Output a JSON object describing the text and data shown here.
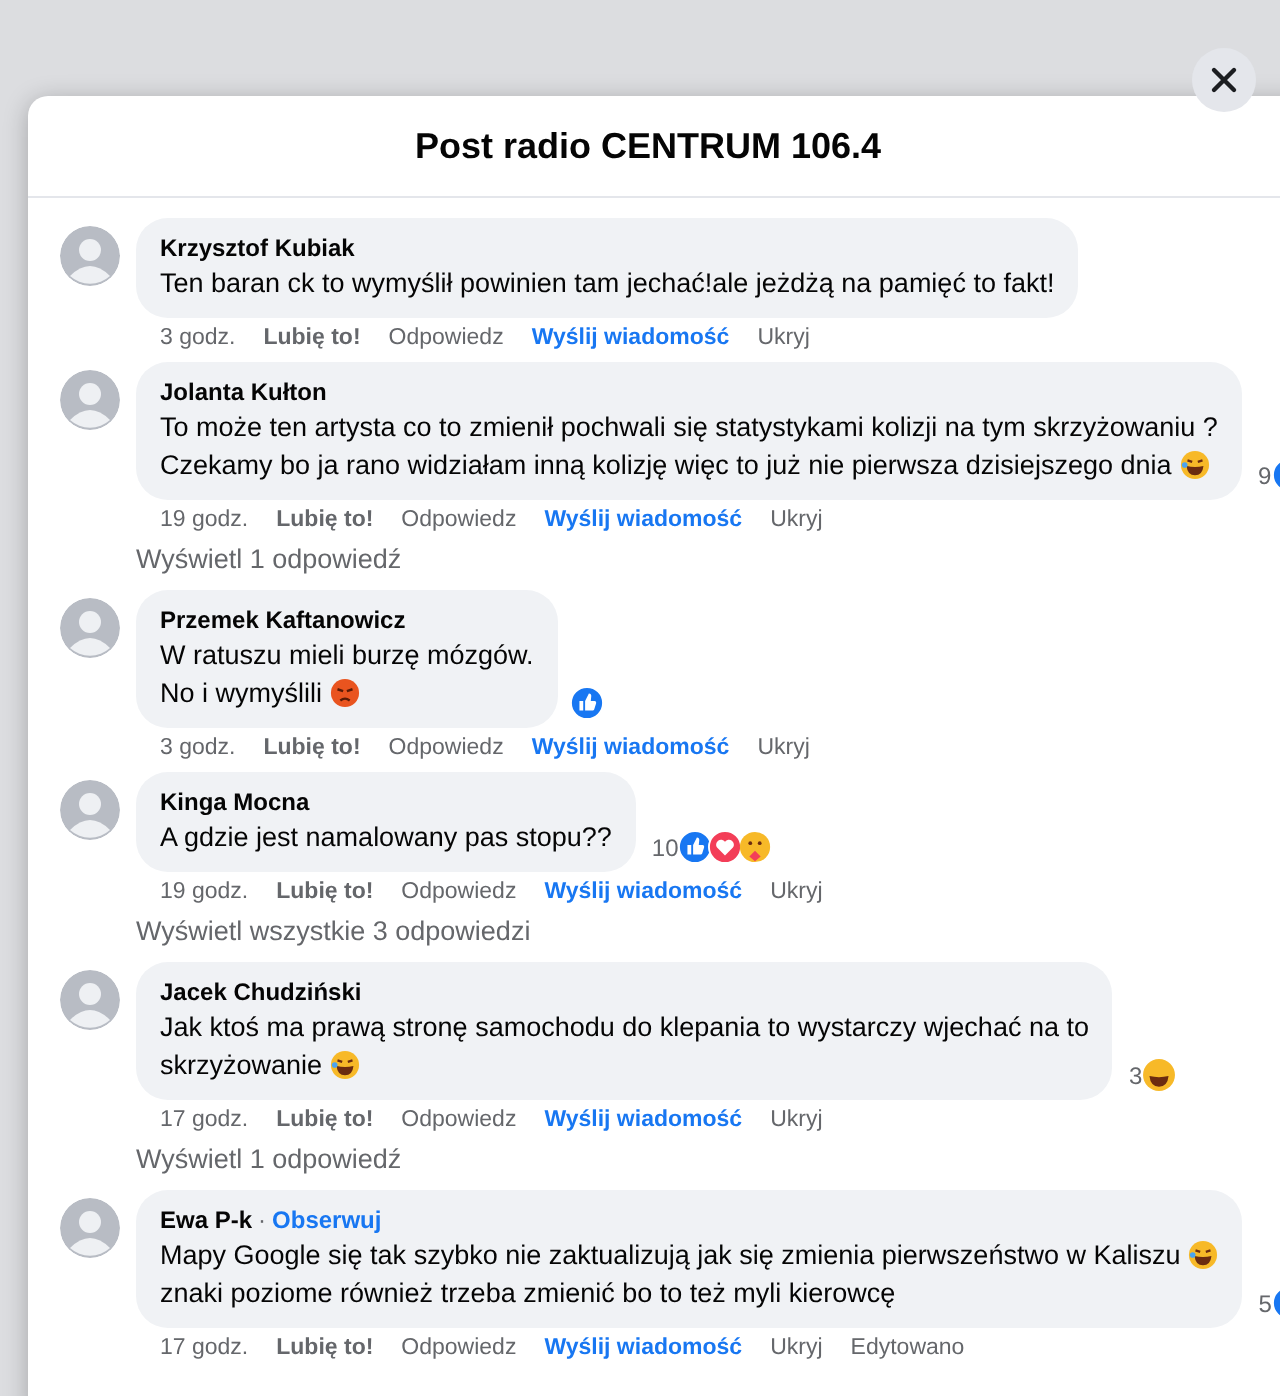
{
  "dialog": {
    "title": "Post radio CENTRUM 106.4"
  },
  "comments": [
    {
      "name": "Krzysztof Kubiak",
      "lines": [
        {
          "text": "Ten baran ck to wymyślił powinien tam jechać!ale jeżdżą na pamięć to fakt!"
        }
      ],
      "time": "3 godz.",
      "actions": [
        "Lubię to!",
        "Odpowiedz"
      ],
      "message": "Wyślij wiadomość",
      "hide": "Ukryj"
    },
    {
      "name": "Jolanta Kułton",
      "lines": [
        {
          "text": "To może ten artysta co to zmienił pochwali się statystykami kolizji na tym skrzyżowaniu ?"
        },
        {
          "text": "Czekamy bo ja rano widziałam inną kolizję więc to już nie pierwsza dzisiejszego dnia",
          "emoji": {
            "kind": "laugh"
          }
        }
      ],
      "time": "19 godz.",
      "actions": [
        "Lubię to!",
        "Odpowiedz"
      ],
      "message": "Wyślij wiadomość",
      "hide": "Ukryj",
      "reactions": {
        "count": "9",
        "icons": [
          {
            "kind": "like"
          }
        ]
      },
      "replies_link": "Wyświetl 1 odpowiedź"
    },
    {
      "name": "Przemek Kaftanowicz",
      "lines": [
        {
          "text": "W ratuszu mieli burzę mózgów."
        },
        {
          "text": "No i wymyślili",
          "emoji": {
            "kind": "angry"
          }
        }
      ],
      "time": "3 godz.",
      "actions": [
        "Lubię to!",
        "Odpowiedz"
      ],
      "message": "Wyślij wiadomość",
      "hide": "Ukryj",
      "reactions": {
        "icons": [
          {
            "kind": "like"
          }
        ]
      }
    },
    {
      "name": "Kinga Mocna",
      "lines": [
        {
          "text": "A gdzie jest namalowany pas stopu??"
        }
      ],
      "time": "19 godz.",
      "actions": [
        "Lubię to!",
        "Odpowiedz"
      ],
      "message": "Wyślij wiadomość",
      "hide": "Ukryj",
      "reactions": {
        "count": "10",
        "icons": [
          {
            "kind": "like"
          },
          {
            "kind": "love"
          },
          {
            "kind": "care"
          }
        ]
      },
      "replies_link": "Wyświetl wszystkie 3 odpowiedzi"
    },
    {
      "name": "Jacek Chudziński",
      "lines": [
        {
          "text": "Jak ktoś ma prawą stronę samochodu do klepania to wystarczy wjechać na to"
        },
        {
          "text": "skrzyżowanie",
          "emoji": {
            "kind": "laugh"
          }
        }
      ],
      "time": "17 godz.",
      "actions": [
        "Lubię to!",
        "Odpowiedz"
      ],
      "message": "Wyślij wiadomość",
      "hide": "Ukryj",
      "reactions": {
        "count": "3",
        "icons": [
          {
            "kind": "laugh"
          }
        ]
      },
      "replies_link": "Wyświetl 1 odpowiedź"
    },
    {
      "name": "Ewa P-k",
      "separator": "·",
      "follow": "Obserwuj",
      "lines": [
        {
          "text": "Mapy Google się tak szybko nie zaktualizują jak się zmienia pierwszeństwo w Kaliszu",
          "emoji": {
            "kind": "laugh"
          }
        },
        {
          "text": "znaki poziome również trzeba zmienić bo to też myli kierowcę"
        }
      ],
      "time": "17 godz.",
      "actions": [
        "Lubię to!",
        "Odpowiedz"
      ],
      "message": "Wyślij wiadomość",
      "hide": "Ukryj",
      "edited": "Edytowano",
      "reactions": {
        "count": "5",
        "icons": [
          {
            "kind": "like"
          }
        ]
      }
    }
  ]
}
